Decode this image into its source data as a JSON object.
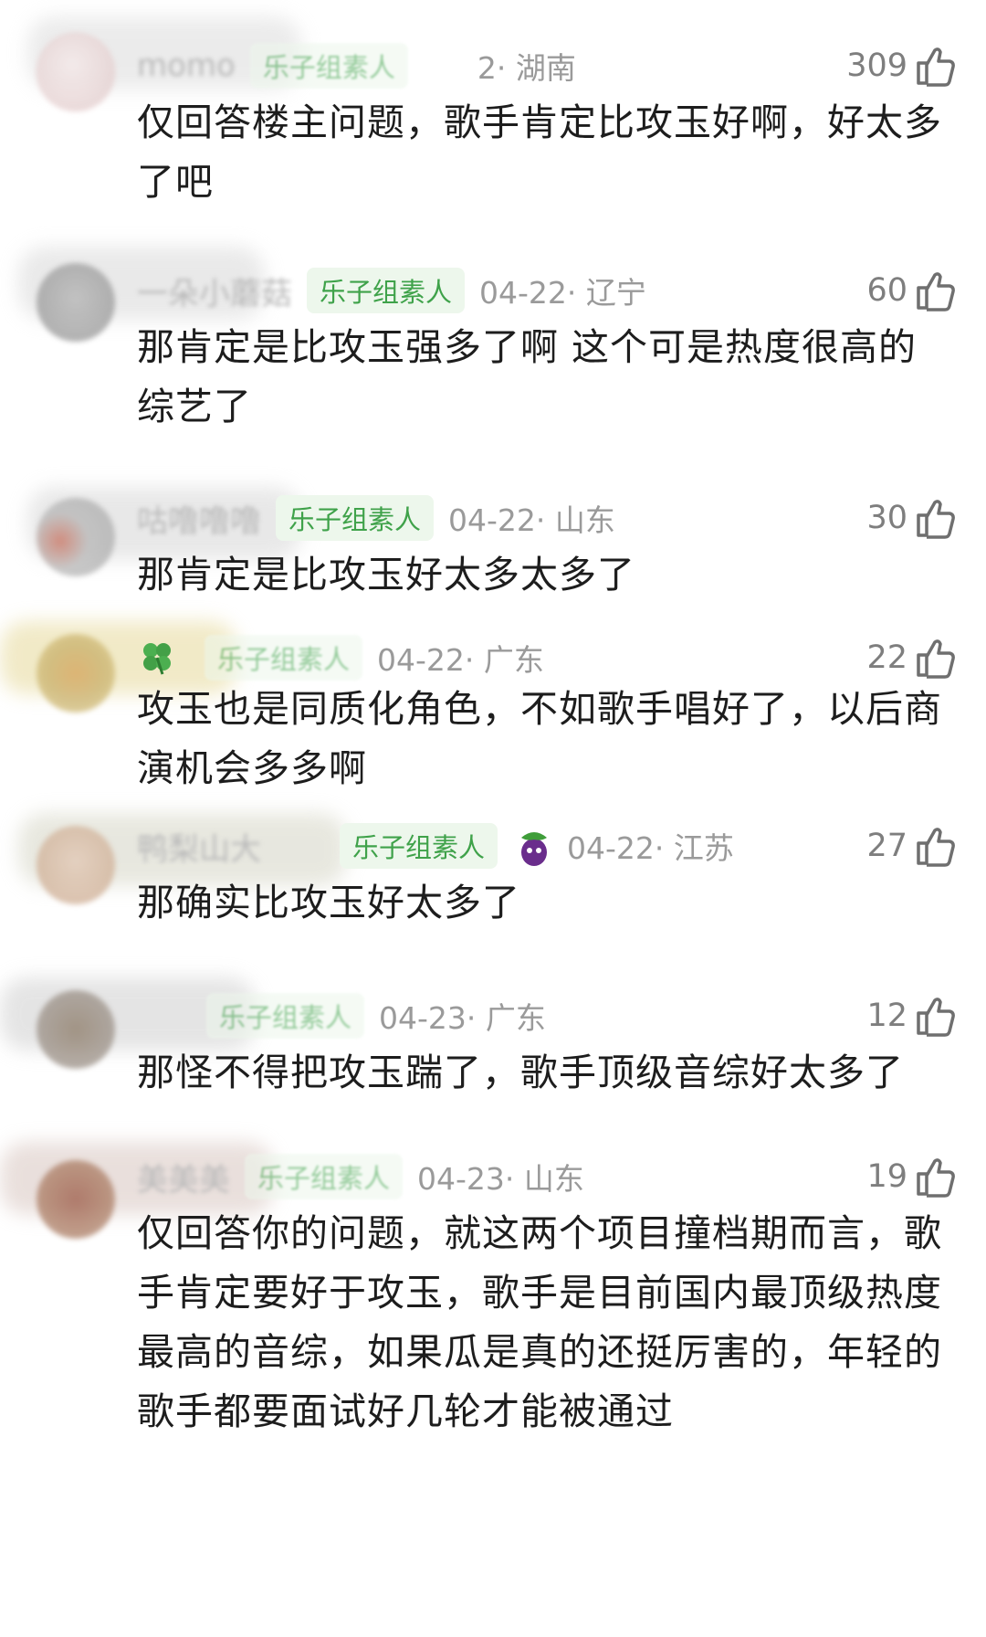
{
  "badge_label": "乐子组素人",
  "comments": [
    {
      "username": "momo",
      "time_location": "2· 湖南",
      "likes": "309",
      "text": "仅回答楼主问题，歌手肯定比攻玉好啊，好太多了吧"
    },
    {
      "username": "一朵小蘑菇",
      "time_location": "04-22· 辽宁",
      "likes": "60",
      "text": "那肯定是比攻玉强多了啊 这个可是热度很高的综艺了"
    },
    {
      "username": "咕噜噜噜",
      "time_location": "04-22· 山东",
      "likes": "30",
      "text": "那肯定是比攻玉好太多太多了"
    },
    {
      "username": "",
      "time_location": "04-22· 广东",
      "likes": "22",
      "text": "攻玉也是同质化角色，不如歌手唱好了，以后商演机会多多啊"
    },
    {
      "username": "鸭梨山大",
      "time_location": "04-22· 江苏",
      "likes": "27",
      "text": "那确实比攻玉好太多了"
    },
    {
      "username": "",
      "time_location": "04-23· 广东",
      "likes": "12",
      "text": "那怪不得把攻玉踹了，歌手顶级音综好太多了"
    },
    {
      "username": "美美美",
      "time_location": "04-23· 山东",
      "likes": "19",
      "text": "仅回答你的问题，就这两个项目撞档期而言，歌手肯定要好于攻玉，歌手是目前国内最顶级热度最高的音综，如果瓜是真的还挺厉害的，年轻的歌手都要面试好几轮才能被通过"
    }
  ],
  "icons": {
    "like": "thumbs-up-icon",
    "clover": "four-leaf-clover-icon",
    "eggplant": "eggplant-emoji-icon"
  },
  "colors": {
    "badge_text": "#3fa24a",
    "badge_bg": "#edf7ec",
    "meta_text": "#9a9a9a",
    "body_text": "#1d1d1d"
  }
}
